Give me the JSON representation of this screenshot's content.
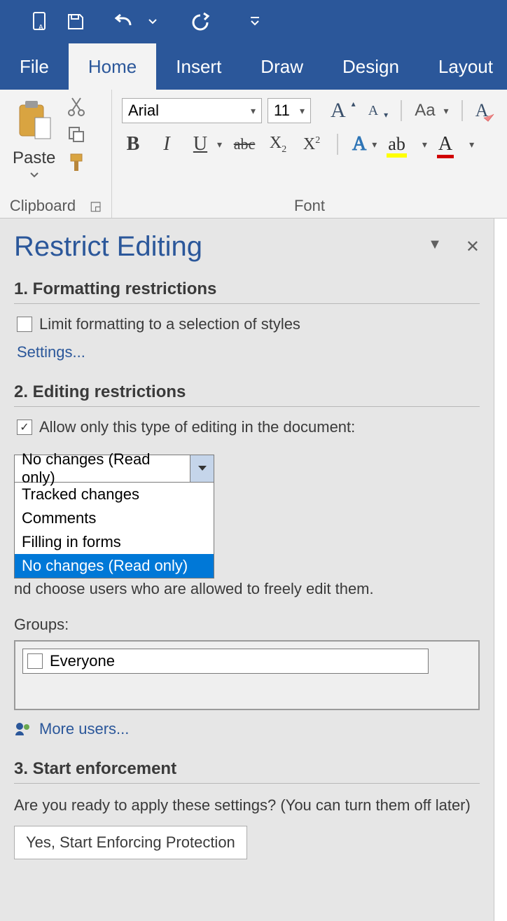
{
  "qat": {
    "touchmode_tip": "Touch/Mouse Mode",
    "save_tip": "Save",
    "undo_tip": "Undo",
    "redo_tip": "Redo"
  },
  "tabs": {
    "file": "File",
    "home": "Home",
    "insert": "Insert",
    "draw": "Draw",
    "design": "Design",
    "layout": "Layout"
  },
  "ribbon": {
    "paste_label": "Paste",
    "clipboard_label": "Clipboard",
    "font_name": "Arial",
    "font_size": "11",
    "font_label": "Font"
  },
  "pane": {
    "title": "Restrict Editing",
    "section1_title": "1. Formatting restrictions",
    "limit_formatting_label": "Limit formatting to a selection of styles",
    "settings_link": "Settings...",
    "section2_title": "2. Editing restrictions",
    "allow_only_label": "Allow only this type of editing in the document:",
    "dd_selected": "No changes (Read only)",
    "dd_options": {
      "opt1": "Tracked changes",
      "opt2": "Comments",
      "opt3": "Filling in forms",
      "opt4": "No changes (Read only)"
    },
    "exceptions_partial": "nd choose users who are allowed to freely edit them.",
    "groups_label": "Groups:",
    "everyone": "Everyone",
    "more_users": "More users...",
    "section3_title": "3. Start enforcement",
    "ready_text": "Are you ready to apply these settings? (You can turn them off later)",
    "enforce_btn": "Yes, Start Enforcing Protection"
  }
}
